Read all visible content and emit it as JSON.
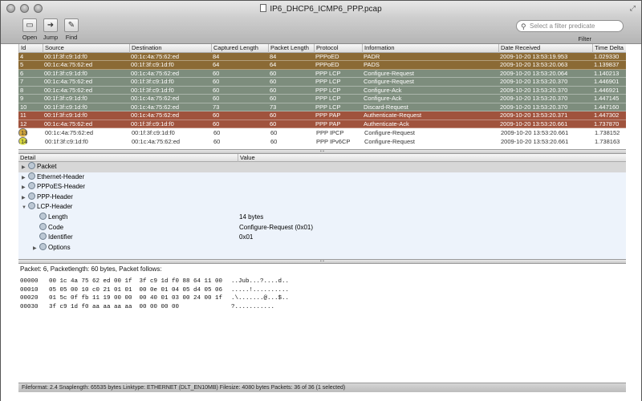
{
  "window": {
    "title": "IP6_DHCP6_ICMP6_PPP.pcap"
  },
  "toolbar": {
    "open": "Open",
    "jump": "Jump",
    "find": "Find"
  },
  "filter": {
    "placeholder": "Select a filter predicate",
    "label": "Filter"
  },
  "packet_list": {
    "columns": [
      "Id",
      "Source",
      "Destination",
      "Captured Length",
      "Packet Length",
      "Protocol",
      "Information",
      "Date Received",
      "Time Delta"
    ],
    "rows": [
      {
        "id": "4",
        "src": "00:1f:3f:c9:1d:f0",
        "dst": "00:1c:4a:75:62:ed",
        "cap": "84",
        "len": "84",
        "proto": "PPPoED",
        "info": "PADR",
        "date": "2009-10-20 13:53:19.953",
        "delta": "1.029330",
        "color": "#8b6a35",
        "light": false
      },
      {
        "id": "5",
        "src": "00:1c:4a:75:62:ed",
        "dst": "00:1f:3f:c9:1d:f0",
        "cap": "64",
        "len": "64",
        "proto": "PPPoED",
        "info": "PADS",
        "date": "2009-10-20 13:53:20.063",
        "delta": "1.139837",
        "color": "#8b6a35",
        "light": false
      },
      {
        "id": "6",
        "src": "00:1f:3f:c9:1d:f0",
        "dst": "00:1c:4a:75:62:ed",
        "cap": "60",
        "len": "60",
        "proto": "PPP LCP",
        "info": "Configure-Request",
        "date": "2009-10-20 13:53:20.064",
        "delta": "1.140213",
        "color": "#7d8d7d",
        "light": false
      },
      {
        "id": "7",
        "src": "00:1c:4a:75:62:ed",
        "dst": "00:1f:3f:c9:1d:f0",
        "cap": "60",
        "len": "60",
        "proto": "PPP LCP",
        "info": "Configure-Request",
        "date": "2009-10-20 13:53:20.370",
        "delta": "1.446901",
        "color": "#7d8d7d",
        "light": false
      },
      {
        "id": "8",
        "src": "00:1c:4a:75:62:ed",
        "dst": "00:1f:3f:c9:1d:f0",
        "cap": "60",
        "len": "60",
        "proto": "PPP LCP",
        "info": "Configure-Ack",
        "date": "2009-10-20 13:53:20.370",
        "delta": "1.446921",
        "color": "#7d8d7d",
        "light": false
      },
      {
        "id": "9",
        "src": "00:1f:3f:c9:1d:f0",
        "dst": "00:1c:4a:75:62:ed",
        "cap": "60",
        "len": "60",
        "proto": "PPP LCP",
        "info": "Configure-Ack",
        "date": "2009-10-20 13:53:20.370",
        "delta": "1.447145",
        "color": "#7d8d7d",
        "light": false
      },
      {
        "id": "10",
        "src": "00:1f:3f:c9:1d:f0",
        "dst": "00:1c:4a:75:62:ed",
        "cap": "73",
        "len": "73",
        "proto": "PPP LCP",
        "info": "Discard-Request",
        "date": "2009-10-20 13:53:20.370",
        "delta": "1.447160",
        "color": "#7d8d7d",
        "light": false
      },
      {
        "id": "11",
        "src": "00:1f:3f:c9:1d:f0",
        "dst": "00:1c:4a:75:62:ed",
        "cap": "60",
        "len": "60",
        "proto": "PPP PAP",
        "info": "Authenticate-Request",
        "date": "2009-10-20 13:53:20.371",
        "delta": "1.447302",
        "color": "#a0533d",
        "light": false
      },
      {
        "id": "12",
        "src": "00:1c:4a:75:62:ed",
        "dst": "00:1f:3f:c9:1d:f0",
        "cap": "60",
        "len": "60",
        "proto": "PPP PAP",
        "info": "Authenticate-Ack",
        "date": "2009-10-20 13:53:20.661",
        "delta": "1.737870",
        "color": "#a0533d",
        "light": false
      },
      {
        "id": "13",
        "src": "00:1c:4a:75:62:ed",
        "dst": "00:1f:3f:c9:1d:f0",
        "cap": "60",
        "len": "60",
        "proto": "PPP IPCP",
        "info": "Configure-Request",
        "date": "2009-10-20 13:53:20.661",
        "delta": "1.738152",
        "color": "#d6aa3e",
        "light": true
      },
      {
        "id": "14",
        "src": "00:1f:3f:c9:1d:f0",
        "dst": "00:1c:4a:75:62:ed",
        "cap": "60",
        "len": "60",
        "proto": "PPP IPv6CP",
        "info": "Configure-Request",
        "date": "2009-10-20 13:53:20.661",
        "delta": "1.738163",
        "color": "#d9da3e",
        "light": true
      }
    ]
  },
  "detail": {
    "columns": [
      "Detail",
      "Value"
    ],
    "nodes": [
      {
        "label": "Packet",
        "value": "",
        "level": 0,
        "disc": "▶",
        "sel": true
      },
      {
        "label": "Ethernet-Header",
        "value": "",
        "level": 0,
        "disc": "▶",
        "sel": false
      },
      {
        "label": "PPPoES-Header",
        "value": "",
        "level": 0,
        "disc": "▶",
        "sel": false
      },
      {
        "label": "PPP-Header",
        "value": "",
        "level": 0,
        "disc": "▶",
        "sel": false
      },
      {
        "label": "LCP-Header",
        "value": "",
        "level": 0,
        "disc": "▼",
        "sel": false
      },
      {
        "label": "Length",
        "value": "14 bytes",
        "level": 1,
        "disc": "",
        "sel": false
      },
      {
        "label": "Code",
        "value": "Configure-Request (0x01)",
        "level": 1,
        "disc": "",
        "sel": false
      },
      {
        "label": "Identifier",
        "value": "0x01",
        "level": 1,
        "disc": "",
        "sel": false
      },
      {
        "label": "Options",
        "value": "",
        "level": 1,
        "disc": "▶",
        "sel": false
      }
    ]
  },
  "hex": {
    "lead": "Packet: 6, Packetlength: 60 bytes, Packet follows:",
    "lines": [
      {
        "off": "00000",
        "bytes": "00 1c 4a 75 62 ed 00 1f  3f c9 1d f0 88 64 11 00",
        "ascii": "..Jub...?....d.."
      },
      {
        "off": "00010",
        "bytes": "05 05 00 10 c0 21 01 01  00 0e 01 04 05 d4 05 06",
        "ascii": ".....!.........."
      },
      {
        "off": "00020",
        "bytes": "01 5c 0f fb 11 19 00 00  00 40 01 03 00 24 00 1f",
        "ascii": ".\\.......@...$.."
      },
      {
        "off": "00030",
        "bytes": "3f c9 1d f0 aa aa aa aa  00 00 00 00",
        "ascii": "?..........."
      }
    ]
  },
  "status": {
    "text": "Fileformat: 2.4   Snaplength: 65535 bytes   Linktype: ETHERNET (DLT_EN10MB)   Filesize: 4080 bytes   Packets: 36 of 36 (1 selected)"
  }
}
